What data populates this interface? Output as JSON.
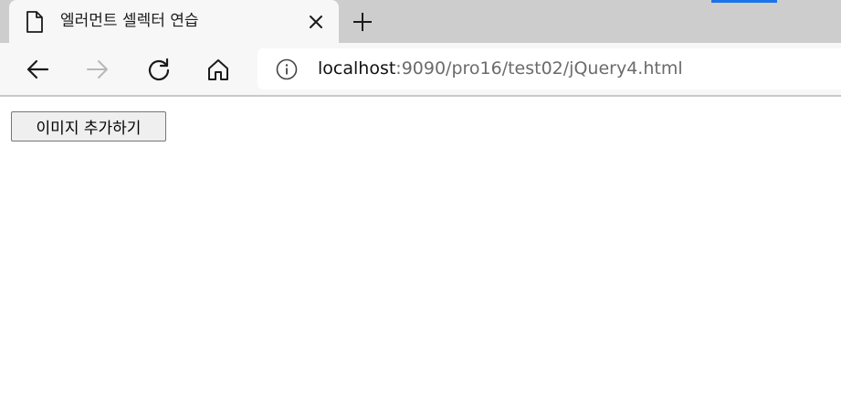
{
  "browser": {
    "accent_color": "#1a73e8",
    "tab": {
      "title": "엘러먼트 셀렉터 연습",
      "icon": "page-icon",
      "close_icon": "close-icon"
    },
    "new_tab_icon": "plus-icon",
    "nav": {
      "back_icon": "back-arrow-icon",
      "forward_icon": "forward-arrow-icon",
      "reload_icon": "reload-icon",
      "home_icon": "home-icon"
    },
    "address": {
      "info_icon": "info-icon",
      "host": "localhost",
      "rest": ":9090/pro16/test02/jQuery4.html"
    }
  },
  "page": {
    "add_button_label": "이미지 추가하기"
  }
}
